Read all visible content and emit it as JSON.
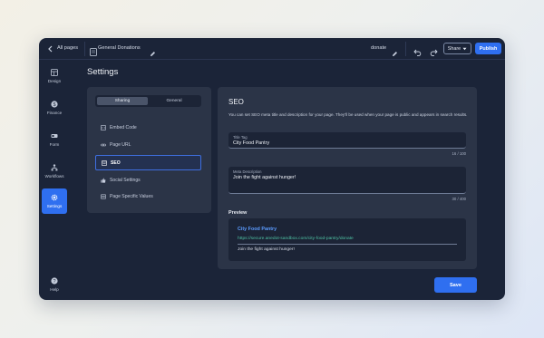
{
  "topbar": {
    "back_label": "All pages",
    "page_title": "General Donations",
    "page_slug": "donate",
    "share_label": "Share",
    "publish_label": "Publish"
  },
  "sidebar": {
    "items": [
      {
        "label": "Design",
        "icon": "design-icon"
      },
      {
        "label": "Finance",
        "icon": "dollar-icon"
      },
      {
        "label": "Form",
        "icon": "form-icon"
      },
      {
        "label": "Workflows",
        "icon": "workflow-icon"
      },
      {
        "label": "Settings",
        "icon": "gear-icon",
        "active": true
      },
      {
        "label": "Help",
        "icon": "help-icon"
      }
    ]
  },
  "settings": {
    "title": "Settings",
    "tabs": [
      "Sharing",
      "General"
    ],
    "selected_tab": "Sharing",
    "menu": [
      {
        "label": "Embed Code",
        "icon": "embed-icon"
      },
      {
        "label": "Page URL",
        "icon": "link-icon"
      },
      {
        "label": "SEO",
        "icon": "seo-icon",
        "active": true
      },
      {
        "label": "Social Settings",
        "icon": "thumbs-up-icon"
      },
      {
        "label": "Page Specific Values",
        "icon": "list-icon"
      }
    ]
  },
  "seo": {
    "title": "SEO",
    "description": "You can set SEO meta title and description for your page. They'll be used when your page is public and appears in search results.",
    "title_tag_label": "Title Tag",
    "title_tag_value": "City Food Pantry",
    "title_tag_count": "16 / 100",
    "meta_label": "Meta Description",
    "meta_value": "Join the fight against hunger!",
    "meta_count": "30 / 400",
    "preview_label": "Preview",
    "preview_title": "City Food Pantry",
    "preview_url": "https://secure.anedot-sandbox.com/city-food-pantry/donate",
    "preview_desc": "Join the fight against hunger!"
  },
  "actions": {
    "save_label": "Save"
  },
  "colors": {
    "accent": "#2f6ff0",
    "background": "#1b2438",
    "panel": "#2b3447",
    "preview_link": "#5b9bff",
    "preview_url": "#4fc3a4"
  }
}
